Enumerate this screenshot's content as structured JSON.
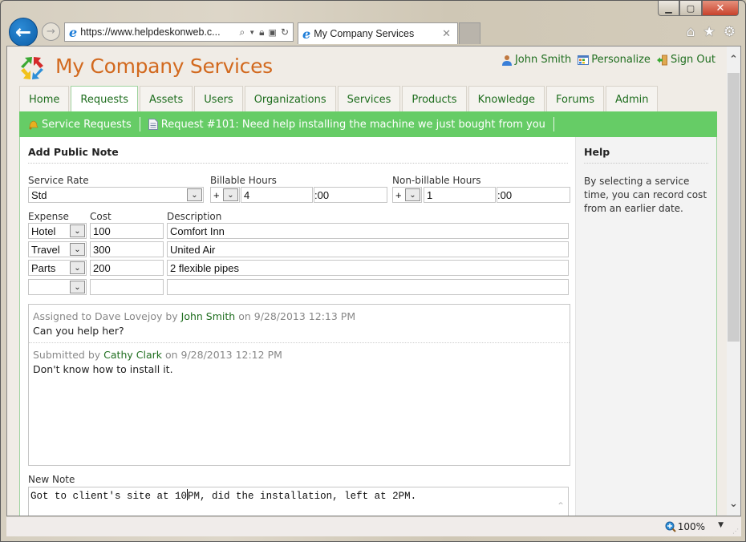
{
  "browser": {
    "url": "https://www.helpdeskonweb.c...",
    "tab_title": "My Company Services",
    "zoom_level": "100%",
    "window_controls": {
      "minimize": "▁",
      "maximize": "▢",
      "close": "✕"
    }
  },
  "header": {
    "site_title": "My Company Services",
    "user_links": [
      {
        "label": "John Smith",
        "icon": "user-icon"
      },
      {
        "label": "Personalize",
        "icon": "personalize-icon"
      },
      {
        "label": "Sign Out",
        "icon": "sign-out-icon"
      }
    ]
  },
  "nav": {
    "tabs": [
      "Home",
      "Requests",
      "Assets",
      "Users",
      "Organizations",
      "Services",
      "Products",
      "Knowledge",
      "Forums",
      "Admin"
    ],
    "active_tab": "Requests"
  },
  "breadcrumb": [
    {
      "label": "Service Requests",
      "icon": "bell-icon"
    },
    {
      "label": "Request #101: Need help installing the machine we just bought from you",
      "icon": "document-icon"
    }
  ],
  "form": {
    "title": "Add Public Note",
    "service_rate": {
      "label": "Service Rate",
      "value": "Std"
    },
    "billable_hours": {
      "label": "Billable Hours",
      "sign": "+",
      "hours": "4",
      "minutes": ":00"
    },
    "nonbillable_hours": {
      "label": "Non-billable Hours",
      "sign": "+",
      "hours": "1",
      "minutes": ":00"
    },
    "expenses": {
      "headers": {
        "expense": "Expense",
        "cost": "Cost",
        "description": "Description"
      },
      "rows": [
        {
          "expense": "Hotel",
          "cost": "100",
          "description": "Comfort Inn"
        },
        {
          "expense": "Travel",
          "cost": "300",
          "description": "United Air"
        },
        {
          "expense": "Parts",
          "cost": "200",
          "description": "2 flexible pipes"
        },
        {
          "expense": "",
          "cost": "",
          "description": ""
        }
      ]
    },
    "history": [
      {
        "prefix": "Assigned to Dave Lovejoy by ",
        "who": "John Smith",
        "suffix": " on 9/28/2013 12:13 PM",
        "body": "Can you help her?"
      },
      {
        "prefix": "Submitted by ",
        "who": "Cathy Clark",
        "suffix": " on 9/28/2013 12:12 PM",
        "body": "Don't know how to install it."
      }
    ],
    "new_note": {
      "label": "New Note",
      "value_before_caret": "Got to client's site at 10",
      "value_after_caret": "PM, did the installation, left at 2PM."
    }
  },
  "help": {
    "title": "Help",
    "text": "By selecting a service time, you can record cost from an earlier date."
  }
}
